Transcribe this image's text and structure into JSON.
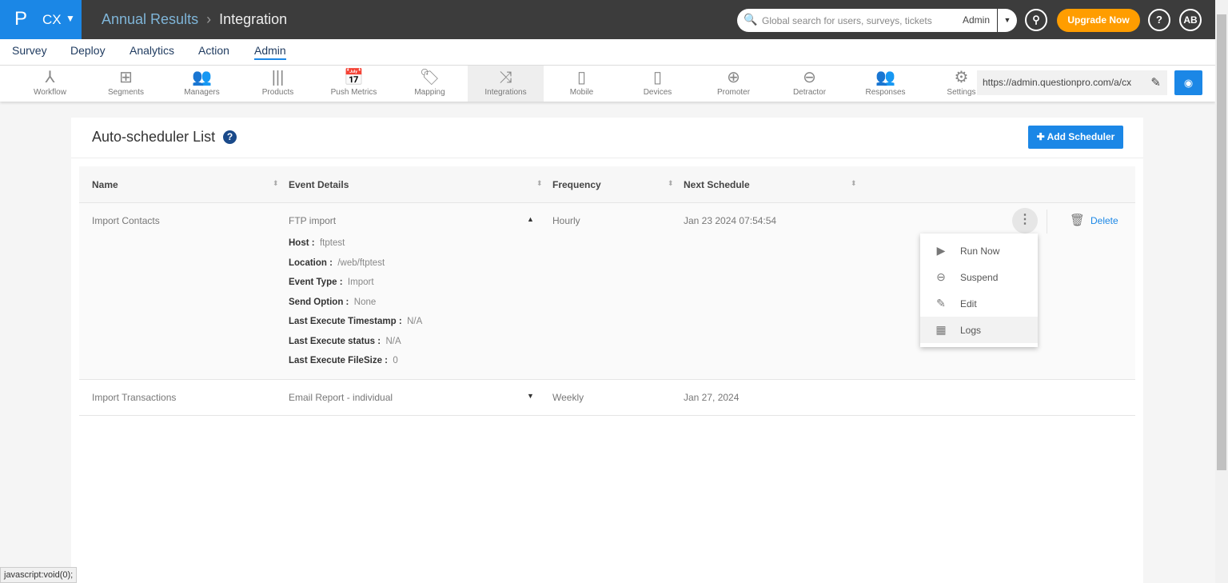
{
  "brand": {
    "logo": "P",
    "product": "CX"
  },
  "breadcrumb": {
    "parent": "Annual Results",
    "current": "Integration"
  },
  "search": {
    "placeholder": "Global search for users, surveys, tickets",
    "scope": "Admin"
  },
  "header": {
    "upgrade": "Upgrade Now",
    "help": "?",
    "avatar": "AB"
  },
  "main_nav": [
    "Survey",
    "Deploy",
    "Analytics",
    "Action",
    "Admin"
  ],
  "main_nav_active": "Admin",
  "sub_nav": [
    {
      "label": "Workflow",
      "icon": "workflow-icon"
    },
    {
      "label": "Segments",
      "icon": "segments-icon"
    },
    {
      "label": "Managers",
      "icon": "managers-icon"
    },
    {
      "label": "Products",
      "icon": "barcode-icon"
    },
    {
      "label": "Push Metrics",
      "icon": "calendar-clock-icon"
    },
    {
      "label": "Mapping",
      "icon": "tag-icon"
    },
    {
      "label": "Integrations",
      "icon": "shuffle-icon"
    },
    {
      "label": "Mobile",
      "icon": "mobile-icon"
    },
    {
      "label": "Devices",
      "icon": "device-icon"
    },
    {
      "label": "Promoter",
      "icon": "plus-bubble-icon"
    },
    {
      "label": "Detractor",
      "icon": "minus-bubble-icon"
    },
    {
      "label": "Responses",
      "icon": "responses-icon"
    },
    {
      "label": "Settings",
      "icon": "gear-icon"
    }
  ],
  "sub_nav_active": "Integrations",
  "url_field": "https://admin.questionpro.com/a/cx",
  "page": {
    "title": "Auto-scheduler List",
    "add_button": "Add Scheduler"
  },
  "table": {
    "columns": [
      "Name",
      "Event Details",
      "Frequency",
      "Next Schedule"
    ],
    "rows": [
      {
        "name": "Import Contacts",
        "event": "FTP import",
        "frequency": "Hourly",
        "next": "Jan 23 2024 07:54:54",
        "expanded": true,
        "details": [
          {
            "k": "Host :",
            "v": "ftptest"
          },
          {
            "k": "Location :",
            "v": "/web/ftptest"
          },
          {
            "k": "Event Type :",
            "v": "Import"
          },
          {
            "k": "Send Option :",
            "v": "None"
          },
          {
            "k": "Last Execute Timestamp :",
            "v": "N/A"
          },
          {
            "k": "Last Execute status :",
            "v": "N/A"
          },
          {
            "k": "Last Execute FileSize :",
            "v": "0"
          }
        ]
      },
      {
        "name": "Import Transactions",
        "event": "Email Report - individual",
        "frequency": "Weekly",
        "next": "Jan 27, 2024",
        "expanded": false
      }
    ],
    "delete_label": "Delete"
  },
  "menu": [
    {
      "label": "Run Now",
      "icon": "play-icon"
    },
    {
      "label": "Suspend",
      "icon": "minus-circle-icon"
    },
    {
      "label": "Edit",
      "icon": "pencil-icon"
    },
    {
      "label": "Logs",
      "icon": "grid-icon"
    }
  ],
  "status_bar": "javascript:void(0);",
  "colors": {
    "accent": "#1b87e6",
    "upgrade": "#ff9d00",
    "topbar": "#3c3c3c"
  }
}
